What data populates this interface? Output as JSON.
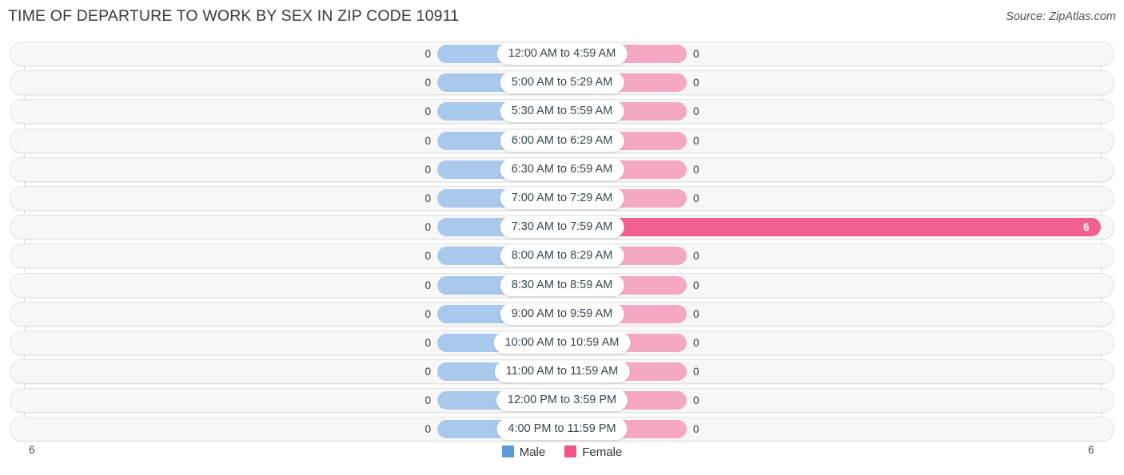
{
  "header": {
    "title": "TIME OF DEPARTURE TO WORK BY SEX IN ZIP CODE 10911",
    "source": "Source: ZipAtlas.com"
  },
  "legend": {
    "male_label": "Male",
    "female_label": "Female",
    "male_color": "#5b9bd5",
    "female_color": "#f2558a"
  },
  "axis": {
    "left_tick": "6",
    "right_tick": "6"
  },
  "colors": {
    "male_bar": "#a8c8ec",
    "female_bar": "#f5a8c3",
    "female_bar_highlight": "#f2608f",
    "track": "#f7f7f7",
    "gridline": "#d8d8d8"
  },
  "chart_data": {
    "type": "bar",
    "subtype": "diverging-bidirectional",
    "title": "TIME OF DEPARTURE TO WORK BY SEX IN ZIP CODE 10911",
    "xlabel": "",
    "ylabel": "",
    "xlim": [
      6,
      6
    ],
    "axis_max": 6,
    "grid": true,
    "legend_position": "bottom-center",
    "categories": [
      "12:00 AM to 4:59 AM",
      "5:00 AM to 5:29 AM",
      "5:30 AM to 5:59 AM",
      "6:00 AM to 6:29 AM",
      "6:30 AM to 6:59 AM",
      "7:00 AM to 7:29 AM",
      "7:30 AM to 7:59 AM",
      "8:00 AM to 8:29 AM",
      "8:30 AM to 8:59 AM",
      "9:00 AM to 9:59 AM",
      "10:00 AM to 10:59 AM",
      "11:00 AM to 11:59 AM",
      "12:00 PM to 3:59 PM",
      "4:00 PM to 11:59 PM"
    ],
    "series": [
      {
        "name": "Male",
        "values": [
          0,
          0,
          0,
          0,
          0,
          0,
          0,
          0,
          0,
          0,
          0,
          0,
          0,
          0
        ],
        "labels": [
          "0",
          "0",
          "0",
          "0",
          "0",
          "0",
          "0",
          "0",
          "0",
          "0",
          "0",
          "0",
          "0",
          "0"
        ]
      },
      {
        "name": "Female",
        "values": [
          0,
          0,
          0,
          0,
          0,
          0,
          6,
          0,
          0,
          0,
          0,
          0,
          0,
          0
        ],
        "labels": [
          "0",
          "0",
          "0",
          "0",
          "0",
          "0",
          "6",
          "0",
          "0",
          "0",
          "0",
          "0",
          "0",
          "0"
        ]
      }
    ]
  }
}
